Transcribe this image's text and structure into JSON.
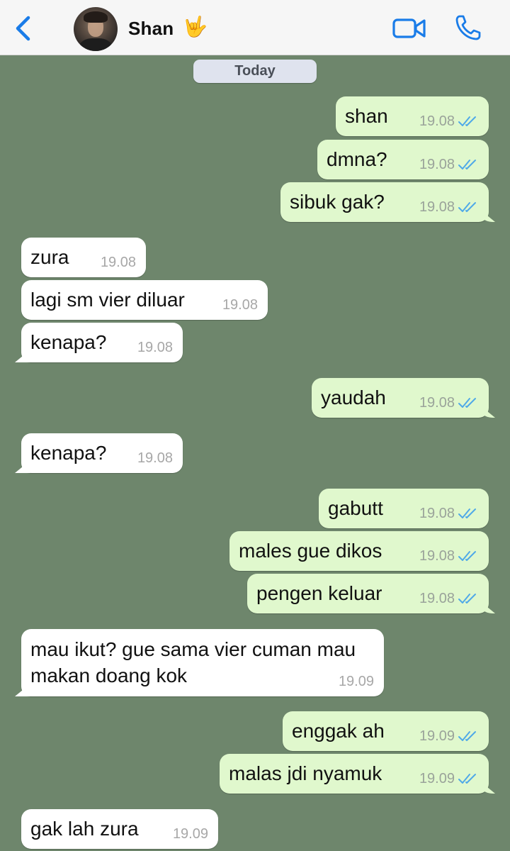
{
  "header": {
    "contact_name": "Shan",
    "contact_emoji": "🤟",
    "back_icon": "chevron-left-icon",
    "video_icon": "video-call-icon",
    "call_icon": "phone-icon",
    "accent_color": "#1a7ce8"
  },
  "date_separator": "Today",
  "messages": [
    {
      "dir": "out",
      "text": "shan",
      "time": "19.08",
      "status": "read"
    },
    {
      "dir": "out",
      "text": "dmna?",
      "time": "19.08",
      "status": "read"
    },
    {
      "dir": "out",
      "text": "sibuk gak?",
      "time": "19.08",
      "status": "read"
    },
    {
      "dir": "in",
      "text": "zura",
      "time": "19.08"
    },
    {
      "dir": "in",
      "text": "lagi sm vier diluar",
      "time": "19.08"
    },
    {
      "dir": "in",
      "text": "kenapa?",
      "time": "19.08"
    },
    {
      "dir": "out",
      "text": "yaudah",
      "time": "19.08",
      "status": "read"
    },
    {
      "dir": "in",
      "text": "kenapa?",
      "time": "19.08"
    },
    {
      "dir": "out",
      "text": "gabutt",
      "time": "19.08",
      "status": "read"
    },
    {
      "dir": "out",
      "text": "males gue dikos",
      "time": "19.08",
      "status": "read"
    },
    {
      "dir": "out",
      "text": "pengen keluar",
      "time": "19.08",
      "status": "read"
    },
    {
      "dir": "in",
      "text": "mau ikut? gue sama vier cuman mau makan doang kok",
      "time": "19.09"
    },
    {
      "dir": "out",
      "text": "enggak ah",
      "time": "19.09",
      "status": "read"
    },
    {
      "dir": "out",
      "text": "malas jdi nyamuk",
      "time": "19.09",
      "status": "read"
    },
    {
      "dir": "in",
      "text": "gak lah zura",
      "time": "19.09"
    }
  ],
  "colors": {
    "chat_background": "#6e866c",
    "outgoing_bubble": "#e0f8cd",
    "incoming_bubble": "#ffffff",
    "read_ticks": "#4fa9e8"
  }
}
